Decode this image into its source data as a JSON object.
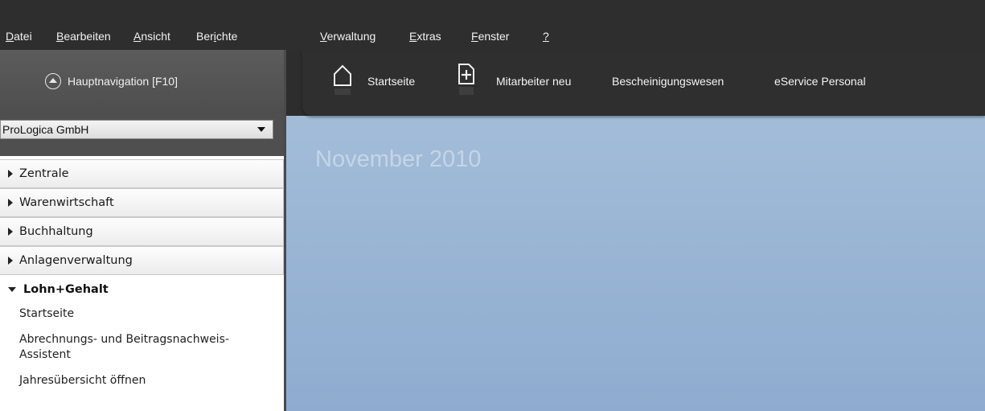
{
  "menu": [
    {
      "label": "Datei",
      "u": "D",
      "rest": "atei"
    },
    {
      "label": "Bearbeiten",
      "u": "B",
      "rest": "earbeiten"
    },
    {
      "label": "Ansicht",
      "u": "A",
      "rest": "nsicht"
    },
    {
      "label": "Berichte",
      "pre": "Ber",
      "u": "i",
      "rest": "chte"
    },
    {
      "label": "Verwaltung",
      "u": "V",
      "rest": "erwaltung"
    },
    {
      "label": "Extras",
      "u": "E",
      "rest": "xtras"
    },
    {
      "label": "Fenster",
      "u": "F",
      "rest": "enster"
    },
    {
      "label": "?",
      "u": "?",
      "rest": ""
    }
  ],
  "sidebar": {
    "nav_label": "Hauptnavigation [F10]",
    "company": "ProLogica GmbH",
    "modules": [
      "Zentrale",
      "Warenwirtschaft",
      "Buchhaltung",
      "Anlagenverwaltung"
    ],
    "open_module": "Lohn+Gehalt",
    "sub_items": [
      "Startseite",
      "Abrechnungs- und Beitragsnachweis-Assistent",
      "Jahresübersicht öffnen"
    ]
  },
  "toolbar": {
    "startseite": "Startseite",
    "mitarbeiter_neu": "Mitarbeiter neu",
    "bescheinigungswesen": "Bescheinigungswesen",
    "eservice": "eService Personal"
  },
  "content": {
    "month_title": "November 2010"
  },
  "colors": {
    "content_bg_top": "#a7c0da",
    "content_bg_bottom": "#8facd0",
    "dark_chrome": "#2e2e2e"
  }
}
